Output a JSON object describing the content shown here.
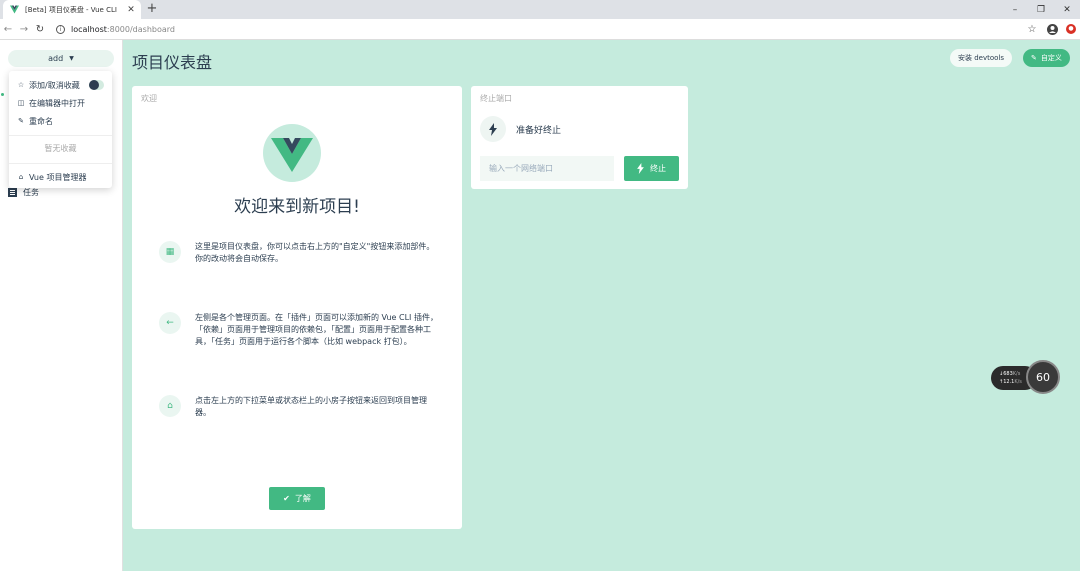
{
  "browser": {
    "tab_title": "[Beta] 项目仪表盘 - Vue CLI",
    "url_host": "localhost",
    "url_path": ":8000/dashboard"
  },
  "sidebar": {
    "project_name": "add",
    "nav": [
      {
        "label": "任务",
        "icon": "tasks-icon"
      }
    ]
  },
  "dropdown": {
    "items": [
      {
        "label": "添加/取消收藏",
        "icon": "star-icon"
      },
      {
        "label": "在编辑器中打开",
        "icon": "editor-icon"
      },
      {
        "label": "重命名",
        "icon": "pencil-icon"
      }
    ],
    "empty_label": "暂无收藏",
    "home_label": "Vue 项目管理器"
  },
  "header": {
    "title": "项目仪表盘",
    "devtools_label": "安装 devtools",
    "customize_label": "自定义"
  },
  "welcome": {
    "card_title": "欢迎",
    "heading": "欢迎来到新项目!",
    "tips": [
      "这里是项目仪表盘，你可以点击右上方的\"自定义\"按钮来添加部件。你的改动将会自动保存。",
      "左侧是各个管理页面。在「插件」页面可以添加新的 Vue CLI 插件，「依赖」页面用于管理项目的依赖包，「配置」页面用于配置各种工具，「任务」页面用于运行各个脚本（比如 webpack 打包）。",
      "点击左上方的下拉菜单或状态栏上的小房子按钮来返回到项目管理器。"
    ],
    "button_label": "了解"
  },
  "kill_port": {
    "card_title": "终止端口",
    "status": "准备好终止",
    "input_placeholder": "输入一个网络端口",
    "button_label": "终止"
  },
  "fps_widget": {
    "download": "683",
    "upload": "12.1",
    "unit": "K/s",
    "fps": "60"
  },
  "colors": {
    "accent": "#42b983",
    "main_bg": "#c5ebdd",
    "text": "#2c3e50"
  }
}
